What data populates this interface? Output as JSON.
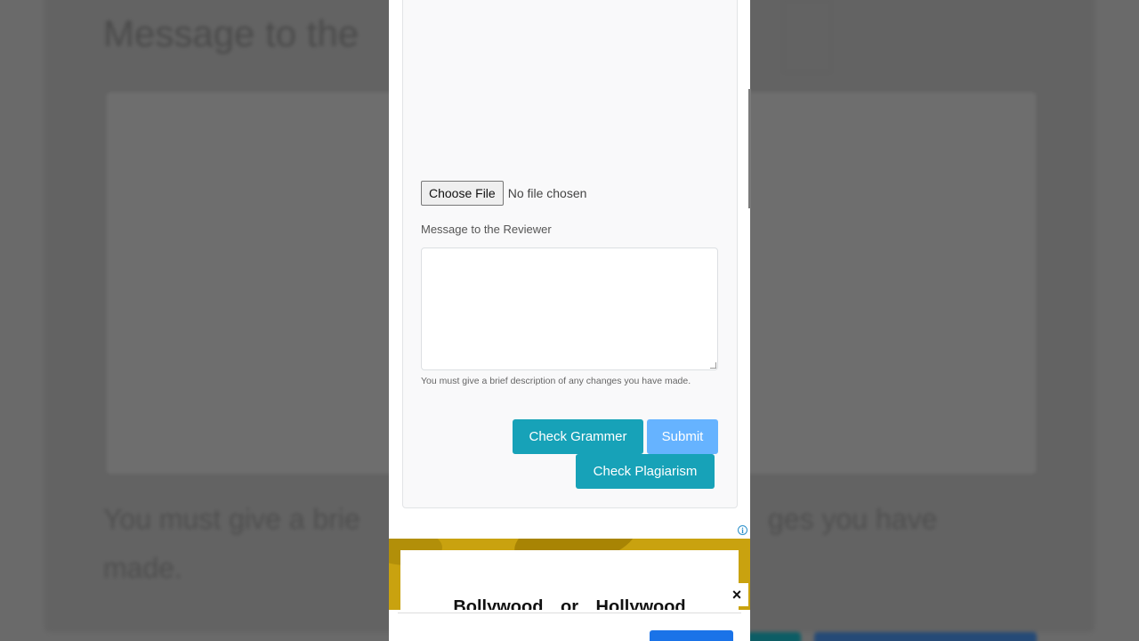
{
  "background": {
    "title": "Message to the",
    "help_left": "You must give a brie",
    "help_right": "ges you have",
    "help_line2": "made."
  },
  "form": {
    "file_button_label": "Choose File",
    "file_status": "No file chosen",
    "message_label": "Message to the Reviewer",
    "message_value": "",
    "help_text": "You must give a brief description of any changes you have made.",
    "check_grammar_label": "Check Grammer",
    "submit_label": "Submit",
    "check_plagiarism_label": "Check Plagiarism"
  },
  "ad": {
    "info_icon": "i",
    "headline": "Bollywood or Hollywood",
    "close_icon": "×"
  },
  "colors": {
    "primary_teal": "#17a2b8",
    "submit_light_blue": "#66b3ff",
    "ad_yellow": "#c9a20f",
    "ad_button_blue": "#1a73e8"
  }
}
